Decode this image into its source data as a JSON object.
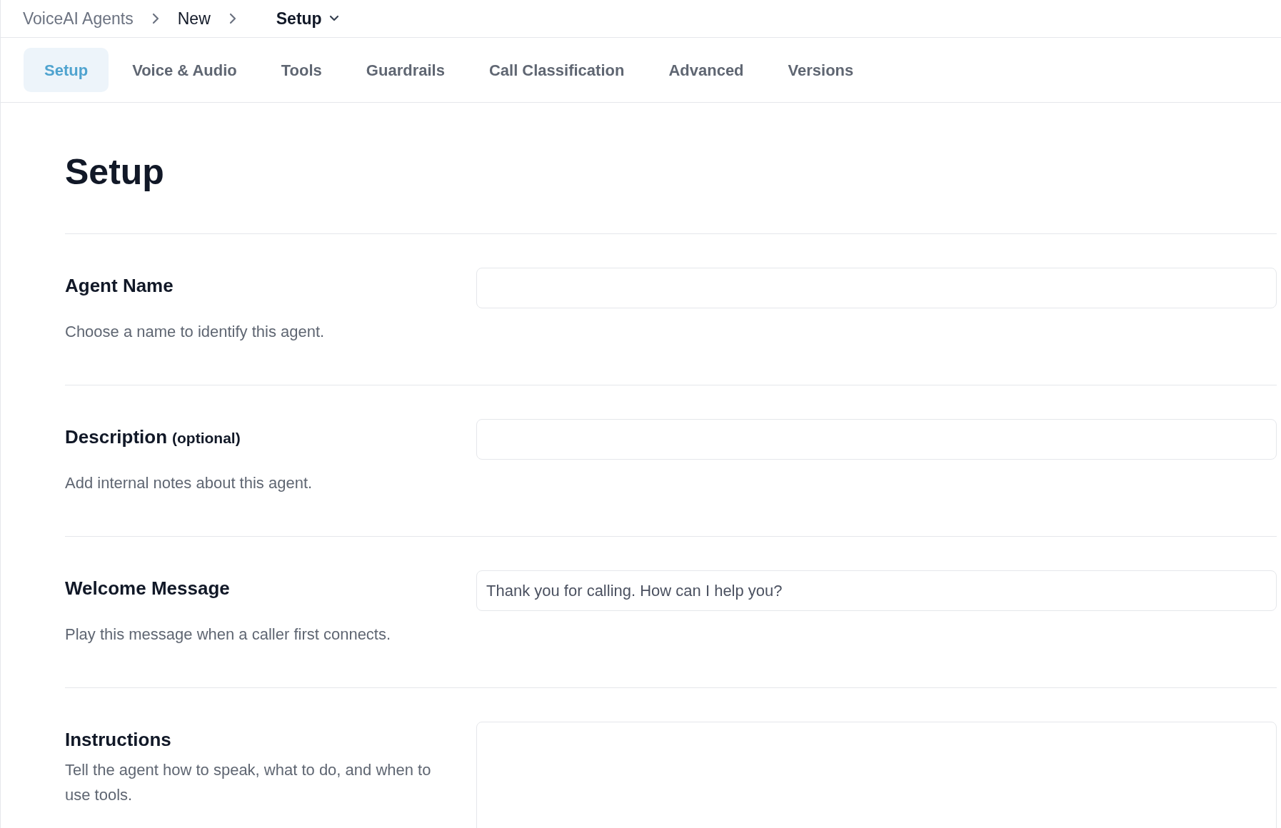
{
  "breadcrumb": [
    {
      "label": "VoiceAI Agents",
      "kind": "link"
    },
    {
      "label": "New",
      "kind": "current"
    },
    {
      "label": "Setup",
      "kind": "dropdown"
    }
  ],
  "tabs": [
    {
      "label": "Setup",
      "selected": true
    },
    {
      "label": "Voice & Audio",
      "selected": false
    },
    {
      "label": "Tools",
      "selected": false
    },
    {
      "label": "Guardrails",
      "selected": false
    },
    {
      "label": "Call Classification",
      "selected": false
    },
    {
      "label": "Advanced",
      "selected": false
    },
    {
      "label": "Versions",
      "selected": false
    }
  ],
  "page_title": "Setup",
  "fields": [
    {
      "label": "Agent Name",
      "description": "Choose a name to identify this agent.",
      "kind": "input"
    },
    {
      "label": "Description",
      "label_note": "(optional)",
      "description": "Add internal notes about this agent.",
      "kind": "input"
    },
    {
      "label": "Welcome Message",
      "description": "Play this message when a caller first connects.",
      "kind": "input",
      "value": "Thank you for calling. How can I help you?"
    },
    {
      "label": "Instructions",
      "description": "Tell the agent how to speak, what to do, and when to use tools.",
      "kind": "textarea"
    }
  ]
}
